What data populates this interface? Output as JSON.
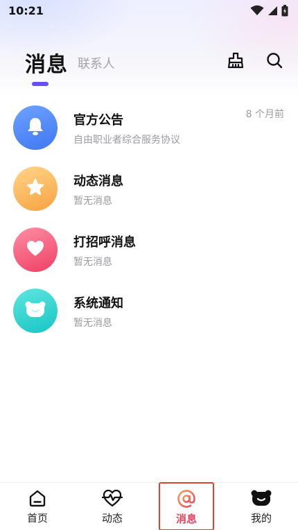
{
  "status_bar": {
    "time": "10:21",
    "icons": [
      "wifi-icon",
      "cellular-signal-icon",
      "battery-icon"
    ]
  },
  "header": {
    "active_tab": "消息",
    "inactive_tab": "联系人",
    "accent_color": "#6a4cf5",
    "icons": [
      "broom-clean-icon",
      "search-icon"
    ]
  },
  "messages": [
    {
      "title": "官方公告",
      "subtitle": "自由职业者综合服务协议",
      "time": "8 个月前",
      "icon": "bell-icon",
      "color": "#4f86f7"
    },
    {
      "title": "动态消息",
      "subtitle": "暂无消息",
      "time": "",
      "icon": "star-icon",
      "color": "#f9b24f"
    },
    {
      "title": "打招呼消息",
      "subtitle": "暂无消息",
      "time": "",
      "icon": "heart-icon",
      "color": "#f04d6d"
    },
    {
      "title": "系统通知",
      "subtitle": "暂无消息",
      "time": "",
      "icon": "bear-face-icon",
      "color": "#22cbc8"
    }
  ],
  "bottom_nav": {
    "items": [
      {
        "label": "首页",
        "icon": "home-icon",
        "active": false
      },
      {
        "label": "动态",
        "icon": "pulse-heart-icon",
        "active": false
      },
      {
        "label": "消息",
        "icon": "at-sign-icon",
        "active": true
      },
      {
        "label": "我的",
        "icon": "bear-face-icon",
        "active": false
      }
    ],
    "active_color": "#e8445d",
    "highlight_border_color": "#e0442f"
  }
}
